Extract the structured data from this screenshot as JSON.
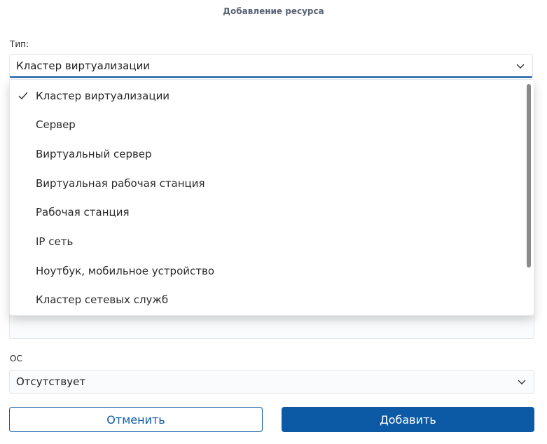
{
  "dialog": {
    "title": "Добавление ресурса"
  },
  "type_field": {
    "label": "Тип:",
    "selected": "Кластер виртуализации",
    "options": [
      "Кластер виртуализации",
      "Сервер",
      "Виртуальный сервер",
      "Виртуальная рабочая станция",
      "Рабочая станция",
      "IP сеть",
      "Ноутбук, мобильное устройство",
      "Кластер сетевых служб"
    ],
    "selected_index": 0
  },
  "os_field": {
    "label": "ОС",
    "selected": "Отсутствует"
  },
  "buttons": {
    "cancel_label": "Отменить",
    "add_label": "Добавить"
  },
  "colors": {
    "accent": "#0c5aa6",
    "title": "#5a6275"
  },
  "icons": {
    "dropdown": "chevron-down-icon",
    "selected": "check-icon"
  }
}
